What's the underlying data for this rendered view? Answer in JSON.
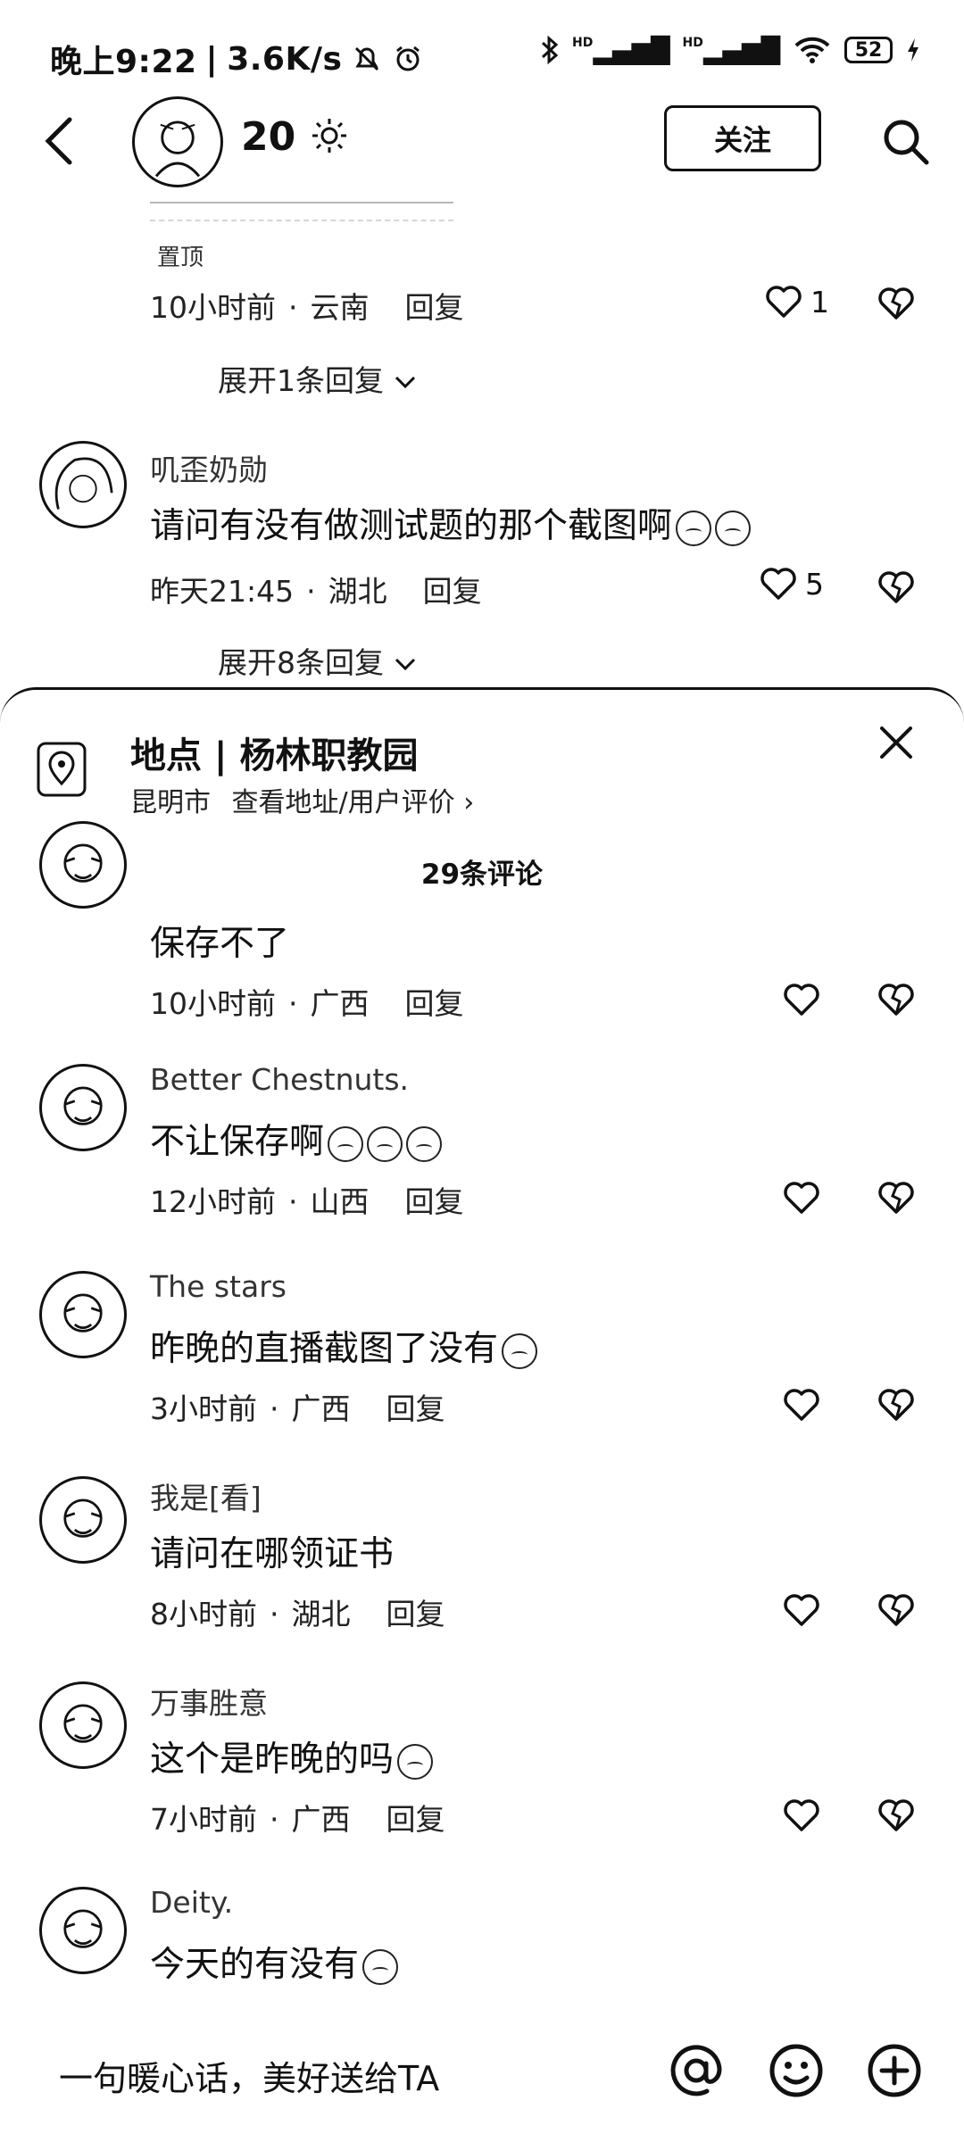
{
  "status_bar": {
    "time": "晚上9:22",
    "net_speed": "3.6K/s",
    "signal_1": "HD",
    "signal_2": "HD",
    "battery": "52"
  },
  "header": {
    "title": "20",
    "follow_label": "关注"
  },
  "top_comments": [
    {
      "pinned_label": "置顶",
      "time": "10小时前",
      "location": "云南",
      "reply_label": "回复",
      "likes": "1",
      "expand_label": "展开1条回复"
    },
    {
      "username": "叽歪奶勋",
      "text": "请问有没有做测试题的那个截图啊",
      "time": "昨天21:45",
      "location": "湖北",
      "reply_label": "回复",
      "likes": "5",
      "expand_label": "展开8条回复"
    }
  ],
  "location_sheet": {
    "title": "地点 | 杨林职教园",
    "city": "昆明市",
    "link": "查看地址/用户评价 ›",
    "comment_count": "29条评论"
  },
  "comments": [
    {
      "username": "",
      "text": "保存不了",
      "time": "10小时前",
      "location": "广西",
      "reply_label": "回复"
    },
    {
      "username": "Better Chestnuts.",
      "text": "不让保存啊",
      "time": "12小时前",
      "location": "山西",
      "reply_label": "回复"
    },
    {
      "username": "The stars",
      "text": "昨晚的直播截图了没有",
      "time": "3小时前",
      "location": "广西",
      "reply_label": "回复"
    },
    {
      "username": "我是[看]",
      "text": "请问在哪领证书",
      "time": "8小时前",
      "location": "湖北",
      "reply_label": "回复"
    },
    {
      "username": "万事胜意",
      "text": "这个是昨晚的吗",
      "time": "7小时前",
      "location": "广西",
      "reply_label": "回复"
    },
    {
      "username": "Deity.",
      "text": "今天的有没有",
      "time": "",
      "location": "",
      "reply_label": ""
    }
  ],
  "input_bar": {
    "placeholder": "一句暖心话，美好送给TA"
  },
  "icons": {
    "back": "chevron-left-icon",
    "search": "search-icon",
    "like": "heart-icon",
    "dislike": "broken-heart-icon",
    "location": "location-pin-icon",
    "close": "close-icon",
    "mention": "at-icon",
    "emoji": "smiley-icon",
    "add": "plus-circle-icon"
  }
}
